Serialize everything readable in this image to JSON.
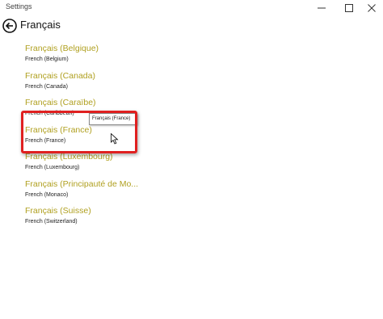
{
  "window": {
    "title": "Settings"
  },
  "header": {
    "title": "Français"
  },
  "languages": [
    {
      "title": "Français (Belgique)",
      "subtitle": "French (Belgium)"
    },
    {
      "title": "Français (Canada)",
      "subtitle": "French (Canada)"
    },
    {
      "title": "Français (Caraïbe)",
      "subtitle": "French (Caribbean)"
    },
    {
      "title": "Français (France)",
      "subtitle": "French (France)"
    },
    {
      "title": "Français (Luxembourg)",
      "subtitle": "French (Luxembourg)"
    },
    {
      "title": "Français (Principauté de Mo...",
      "subtitle": "French (Monaco)"
    },
    {
      "title": "Français (Suisse)",
      "subtitle": "French (Switzerland)"
    }
  ],
  "tooltip": {
    "text": "Français (France)"
  },
  "colors": {
    "accent": "#b0a020",
    "highlight_border": "#e02020"
  },
  "icons": {
    "back": "back-arrow-icon",
    "minimize": "minimize-icon",
    "maximize": "maximize-icon",
    "close": "close-icon",
    "cursor": "mouse-pointer-icon"
  }
}
